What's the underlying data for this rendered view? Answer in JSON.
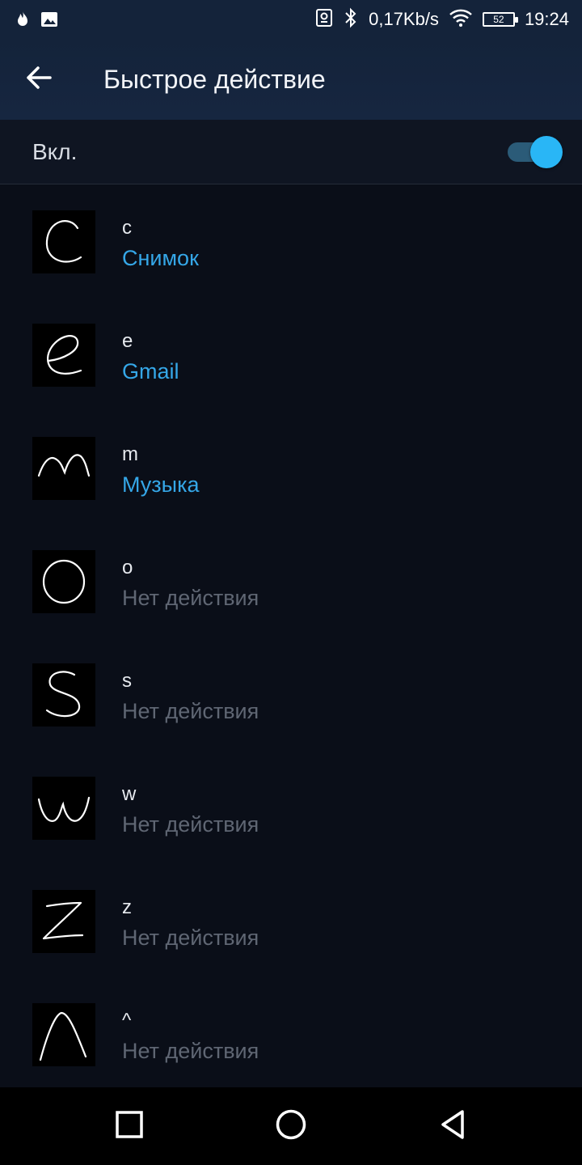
{
  "status_bar": {
    "network_speed": "0,17Kb/s",
    "battery_level": "52",
    "time": "19:24",
    "icons": [
      "flame-icon",
      "image-icon",
      "vpn-key-icon",
      "bluetooth-icon",
      "wifi-icon",
      "battery-icon"
    ]
  },
  "app_bar": {
    "title": "Быстрое действие",
    "back_icon": "arrow-back-icon"
  },
  "toggle": {
    "label": "Вкл.",
    "checked": true,
    "accent_color": "#29b6f6"
  },
  "gestures": {
    "items": [
      {
        "letter": "c",
        "action": "Снимок",
        "assigned": true
      },
      {
        "letter": "e",
        "action": "Gmail",
        "assigned": true
      },
      {
        "letter": "m",
        "action": "Музыка",
        "assigned": true
      },
      {
        "letter": "o",
        "action": "Нет действия",
        "assigned": false
      },
      {
        "letter": "s",
        "action": "Нет действия",
        "assigned": false
      },
      {
        "letter": "w",
        "action": "Нет действия",
        "assigned": false
      },
      {
        "letter": "z",
        "action": "Нет действия",
        "assigned": false
      },
      {
        "letter": "^",
        "action": "Нет действия",
        "assigned": false
      }
    ]
  },
  "colors": {
    "assigned_action": "#35a7e8",
    "unassigned_action": "#5f6673",
    "header_background": "#14233a",
    "page_background": "#0a0e18"
  },
  "nav_bar": {
    "icons": [
      "recent-apps-icon",
      "home-icon",
      "back-triangle-icon"
    ]
  }
}
